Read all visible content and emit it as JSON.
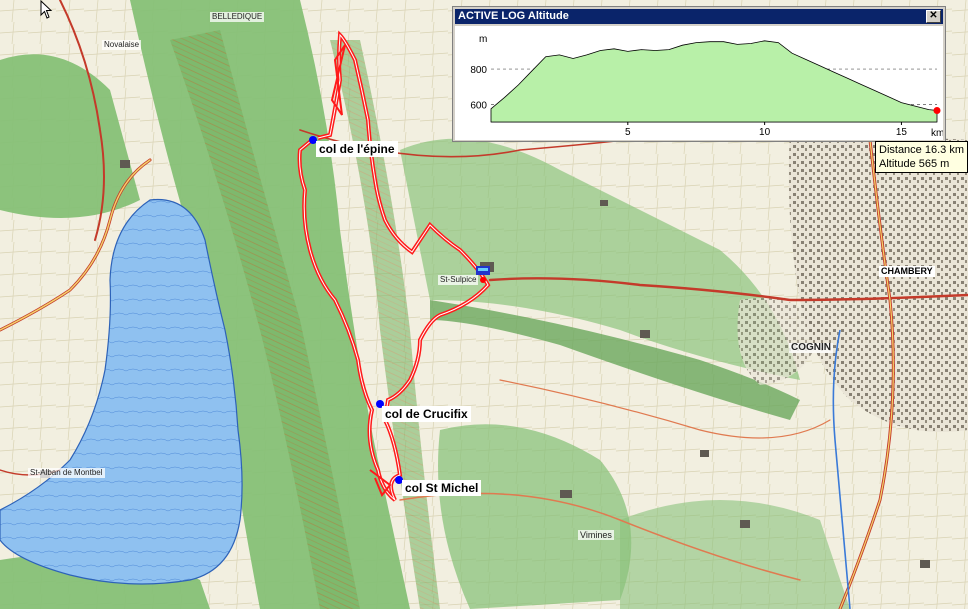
{
  "map": {
    "waypoints": [
      {
        "id": "col-epine",
        "label": "col de l'épine"
      },
      {
        "id": "col-crucifix",
        "label": "col de Crucifix"
      },
      {
        "id": "col-st-michel",
        "label": "col St Michel"
      }
    ],
    "place_labels": {
      "chambery": "CHAMBERY",
      "cognin": "COGNIN",
      "st_sulpice": "St-Sulpice",
      "viminès": "Vimines",
      "st_alban": "St-Alban de Montbel",
      "novalaise": "Novalaise",
      "belledigue": "BELLEDIQUE"
    },
    "colors": {
      "track": "#ff1a1a",
      "lake": "#7fb6ee",
      "forest": "#79b76a",
      "road": "#c43a2a",
      "waypoint": "#0000ff"
    }
  },
  "altitude_window": {
    "title": "ACTIVE LOG Altitude",
    "close_glyph": "✕",
    "y_unit": "m",
    "x_unit": "km",
    "y_ticks": [
      "800",
      "600"
    ],
    "x_ticks": [
      "5",
      "10",
      "15"
    ]
  },
  "chart_data": {
    "type": "area",
    "title": "ACTIVE LOG Altitude",
    "xlabel": "km",
    "ylabel": "m",
    "xlim": [
      0,
      16.3
    ],
    "ylim": [
      500,
      1010
    ],
    "grid": true,
    "x": [
      0,
      0.5,
      1,
      1.5,
      2,
      2.5,
      3,
      3.5,
      4,
      4.5,
      5,
      5.5,
      6,
      6.5,
      7,
      7.5,
      8,
      8.5,
      9,
      9.5,
      10,
      10.5,
      11,
      11.5,
      12,
      12.5,
      13,
      13.5,
      14,
      14.5,
      15,
      15.5,
      16,
      16.3
    ],
    "values": [
      575,
      640,
      710,
      790,
      870,
      880,
      860,
      880,
      905,
      915,
      900,
      910,
      905,
      910,
      935,
      950,
      955,
      955,
      940,
      945,
      960,
      950,
      890,
      855,
      820,
      785,
      750,
      715,
      680,
      645,
      610,
      590,
      570,
      565
    ]
  },
  "readout": {
    "distance": "Distance 16.3 km",
    "altitude": "Altitude 565 m"
  }
}
